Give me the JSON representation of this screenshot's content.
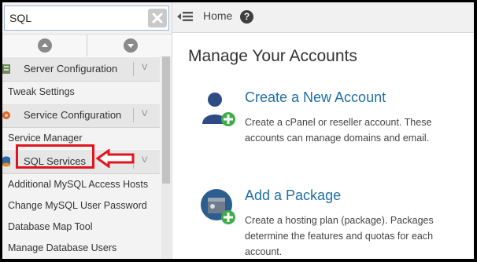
{
  "search": {
    "value": "SQL"
  },
  "sidebar": {
    "items": [
      {
        "type": "category",
        "label": "Server Configuration"
      },
      {
        "type": "item",
        "label": "Tweak Settings"
      },
      {
        "type": "category",
        "label": "Service Configuration"
      },
      {
        "type": "item",
        "label": "Service Manager"
      },
      {
        "type": "category",
        "label": "SQL Services"
      },
      {
        "type": "item",
        "label": "Additional MySQL Access Hosts"
      },
      {
        "type": "item",
        "label": "Change MySQL User Password"
      },
      {
        "type": "item",
        "label": "Database Map Tool"
      },
      {
        "type": "item",
        "label": "Manage Database Users"
      }
    ],
    "chevron": "V"
  },
  "topbar": {
    "breadcrumb": "Home",
    "help": "?"
  },
  "main": {
    "title": "Manage Your Accounts",
    "actions": [
      {
        "title": "Create a New Account",
        "description": "Create a cPanel or reseller account. These accounts can manage domains and email.",
        "icon": "user-add-icon"
      },
      {
        "title": "Add a Package",
        "description": "Create a hosting plan (package). Packages determine the features and quotas for each account.",
        "icon": "package-add-icon"
      }
    ]
  },
  "colors": {
    "highlight": "#e0141e",
    "link": "#1f6fa6",
    "accent": "#3fae49"
  }
}
